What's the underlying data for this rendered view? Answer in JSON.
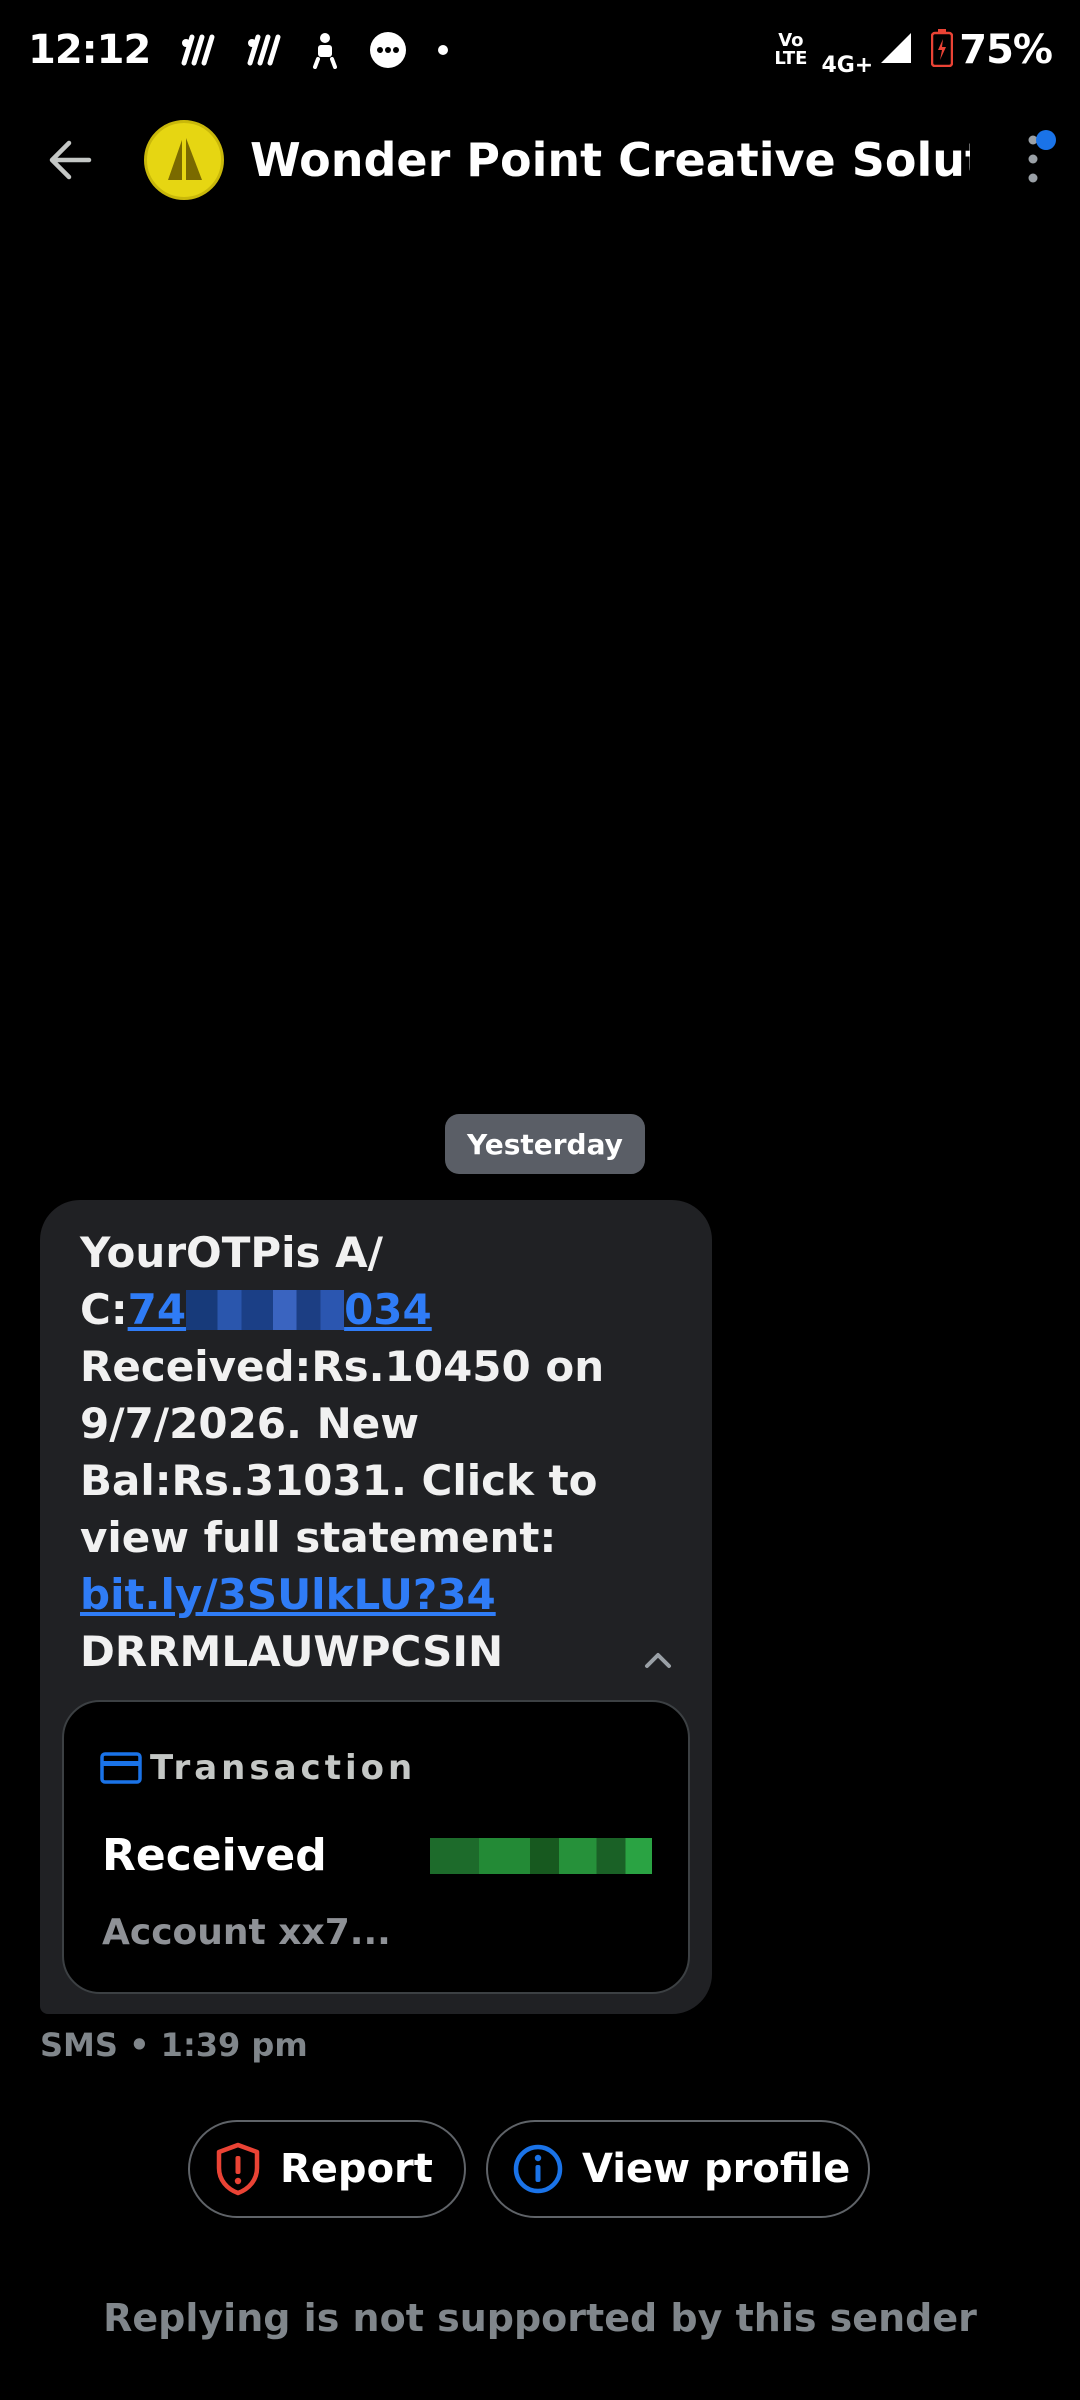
{
  "status_bar": {
    "time": "12:12",
    "network_label_top": "Vo",
    "network_label_bottom": "LTE",
    "network_type": "4G+",
    "battery": "75%"
  },
  "header": {
    "title": "Wonder Point Creative Soluti...",
    "avatar_color": "#e6d612"
  },
  "conversation": {
    "date_chip": "Yesterday",
    "message": {
      "line1": "YourOTPis A/",
      "acct_prefix": "C:",
      "acct_start": "74",
      "acct_end": "034",
      "line3": "Received:Rs.10450 on",
      "line4": "9/7/2026. New",
      "line5": "Bal:Rs.31031. Click to",
      "line6": "view full statement:",
      "link": "bit.ly/3SUlkLU?34",
      "line8": "DRRMLAUWPCSIN"
    },
    "transaction": {
      "label": "Transaction",
      "status": "Received",
      "account": "Account xx7..."
    },
    "meta": "SMS • 1:39 pm"
  },
  "actions": {
    "report": "Report",
    "view_profile": "View profile"
  },
  "footer_note": "Replying is not supported by this sender",
  "colors": {
    "background": "#000000",
    "bubble": "#202124",
    "link": "#2f7cf6",
    "report_icon": "#ea4335",
    "profile_icon": "#1a73e8"
  }
}
